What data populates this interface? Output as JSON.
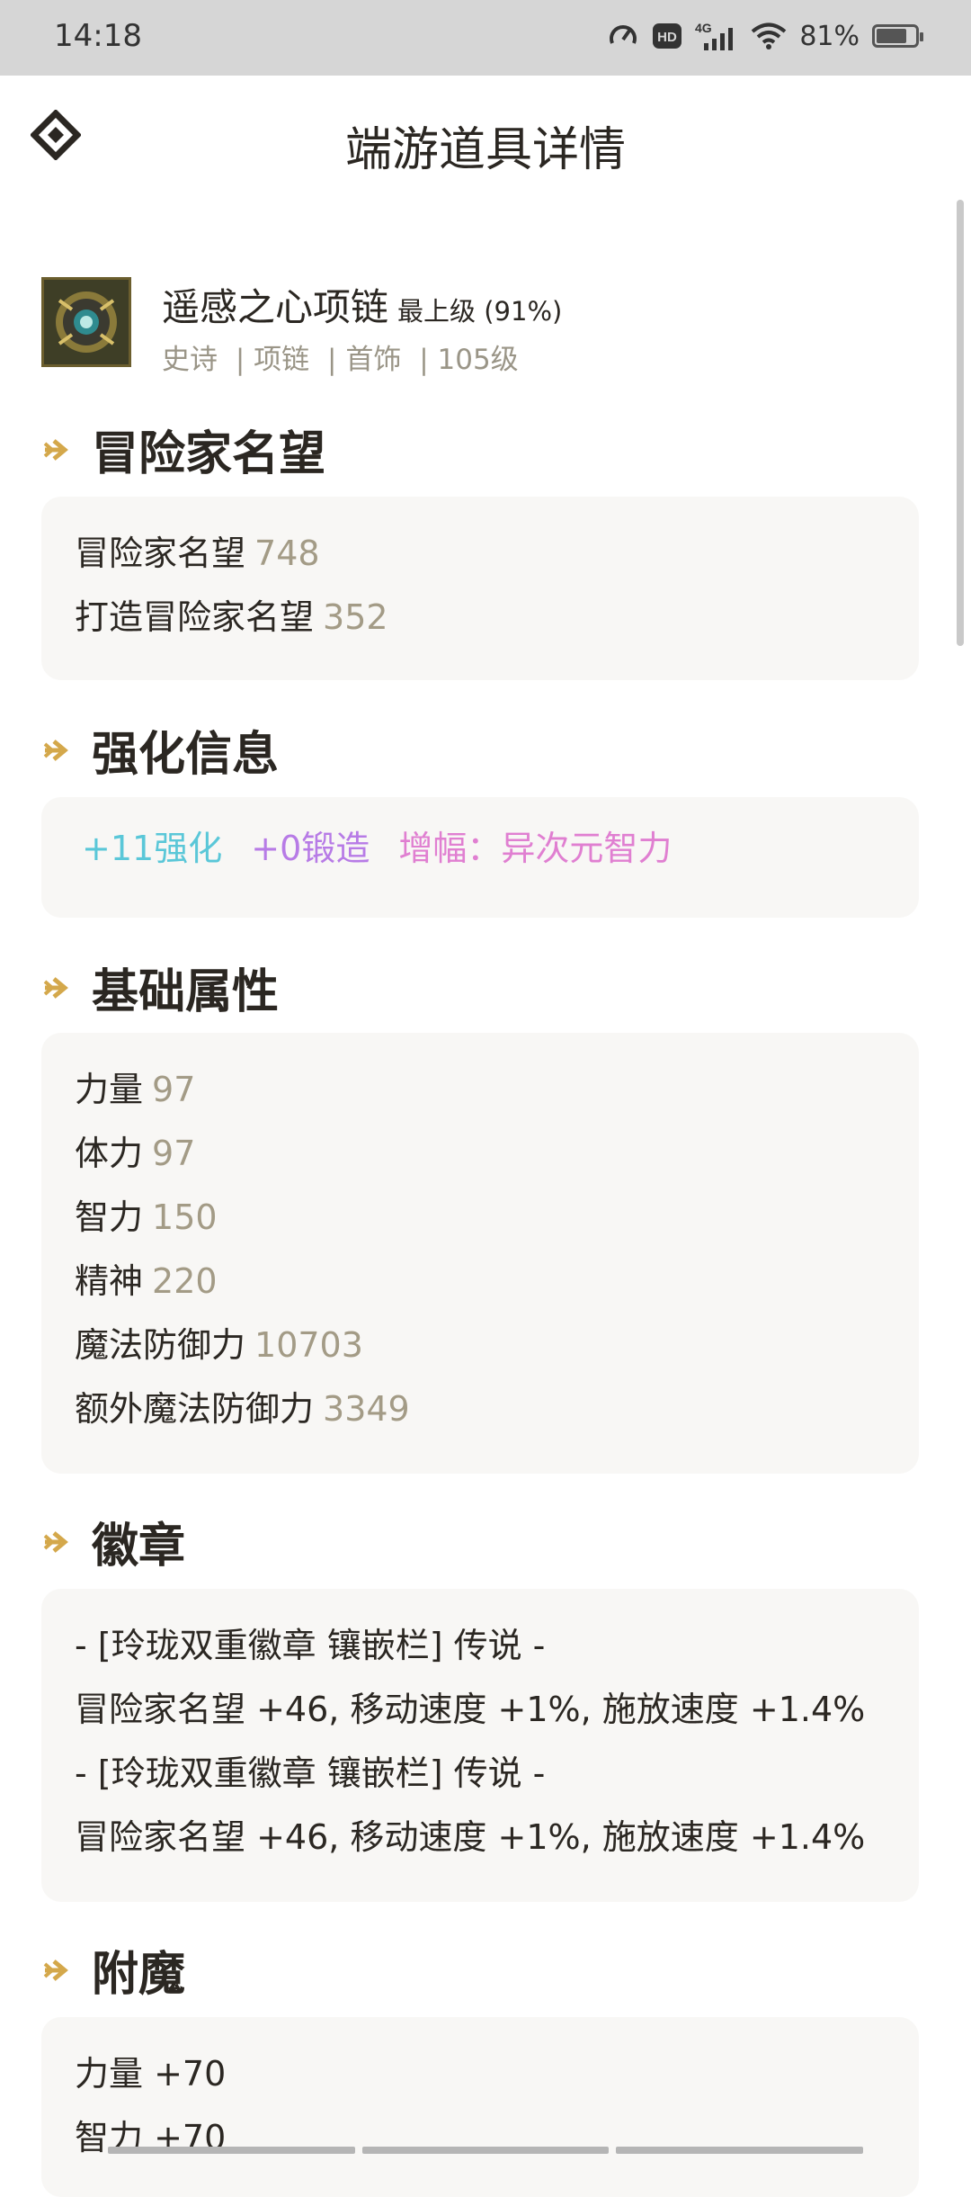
{
  "status_bar": {
    "time": "14:18",
    "icons": [
      "speed-icon",
      "hd-icon",
      "signal-4g-icon",
      "wifi-icon"
    ],
    "network_label": "4G",
    "hd_label": "HD",
    "battery_percent": "81%",
    "battery_level": 0.81
  },
  "header": {
    "title": "端游道具详情"
  },
  "item": {
    "name": "遥感之心项链",
    "grade": "最上级 (91%)",
    "tags": [
      "史诗",
      "| 项链",
      "| 首饰",
      "| 105级"
    ]
  },
  "sections": {
    "reputation": {
      "title": "冒险家名望",
      "lines": [
        {
          "label": "冒险家名望",
          "value": "748"
        },
        {
          "label": "打造冒险家名望",
          "value": "352"
        }
      ]
    },
    "enhance": {
      "title": "强化信息",
      "items": [
        {
          "text": "+11强化",
          "color": "#5ac7d8"
        },
        {
          "text": "+0锻造",
          "color": "#b77be6"
        },
        {
          "text": "增幅：异次元智力",
          "color": "#e07fd1"
        }
      ]
    },
    "base": {
      "title": "基础属性",
      "lines": [
        {
          "label": "力量",
          "value": "97"
        },
        {
          "label": "体力",
          "value": "97"
        },
        {
          "label": "智力",
          "value": "150"
        },
        {
          "label": "精神",
          "value": "220"
        },
        {
          "label": "魔法防御力",
          "value": "10703"
        },
        {
          "label": "额外魔法防御力",
          "value": "3349"
        }
      ]
    },
    "emblem": {
      "title": "徽章",
      "lines": [
        "- [玲珑双重徽章 镶嵌栏] 传说 -",
        "冒险家名望 +46, 移动速度 +1%, 施放速度 +1.4%",
        "- [玲珑双重徽章 镶嵌栏] 传说 -",
        "冒险家名望 +46, 移动速度 +1%, 施放速度 +1.4%"
      ]
    },
    "enchant": {
      "title": "附魔",
      "lines": [
        "力量 +70",
        "智力 +70"
      ]
    }
  },
  "colors": {
    "accent_arrow": "#d4a84b",
    "value_text": "#a39b86",
    "card_bg": "#f8f7f5"
  }
}
